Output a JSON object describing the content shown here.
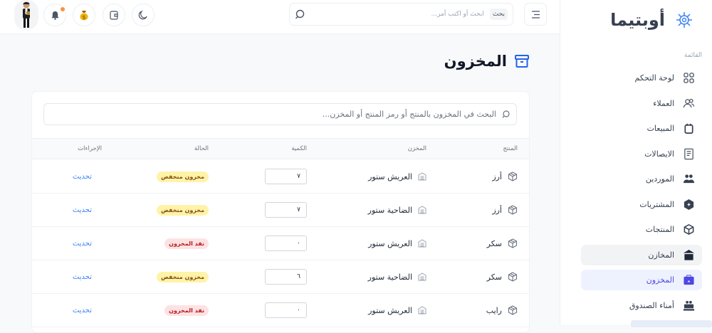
{
  "sidebar": {
    "brand": "أوبتيما",
    "menu_label": "القائمة",
    "items": [
      {
        "label": "لوحة التحكم",
        "icon": "grid-icon"
      },
      {
        "label": "العملاء",
        "icon": "users-icon"
      },
      {
        "label": "المبيعات",
        "icon": "bag-icon"
      },
      {
        "label": "الايصالات",
        "icon": "receipt-icon"
      },
      {
        "label": "الموردين",
        "icon": "group-icon"
      },
      {
        "label": "المشتريات",
        "icon": "hexagon-plus-icon"
      },
      {
        "label": "المنتجات",
        "icon": "cube-icon"
      },
      {
        "label": "المخازن",
        "icon": "warehouse-icon"
      },
      {
        "label": "المخزون",
        "icon": "inventory-icon"
      },
      {
        "label": "أمناء الصندوق",
        "icon": "cashier-icon"
      }
    ]
  },
  "topbar": {
    "search_kbd": "بحث",
    "search_placeholder": "ابحث أو اكتب أمر..."
  },
  "page": {
    "title": "المخزون"
  },
  "table": {
    "search_placeholder": "البحث في المخزون بالمنتج أو رمز المنتج أو المخزن...",
    "headers": [
      "المنتج",
      "المخزن",
      "الكمية",
      "الحالة",
      "الإجراءات"
    ],
    "rows": [
      {
        "product": "أرز",
        "warehouse": "العريش ستور",
        "qty": "٧",
        "status": "مخزون منخفض",
        "status_type": "low",
        "action": "تحديث"
      },
      {
        "product": "أرز",
        "warehouse": "الضاحية ستور",
        "qty": "٧",
        "status": "مخزون منخفض",
        "status_type": "low",
        "action": "تحديث"
      },
      {
        "product": "سكر",
        "warehouse": "العريش ستور",
        "qty": "٠",
        "status": "نفد المخزون",
        "status_type": "out",
        "action": "تحديث"
      },
      {
        "product": "سكر",
        "warehouse": "الضاحية ستور",
        "qty": "٦",
        "status": "مخزون منخفض",
        "status_type": "low",
        "action": "تحديث"
      },
      {
        "product": "رايب",
        "warehouse": "العريش ستور",
        "qty": "٠",
        "status": "نفد المخزون",
        "status_type": "out",
        "action": "تحديث"
      }
    ]
  },
  "colors": {
    "accent": "#4f46e5",
    "low_bg": "#fef3a8",
    "out_bg": "#fde2e4"
  }
}
